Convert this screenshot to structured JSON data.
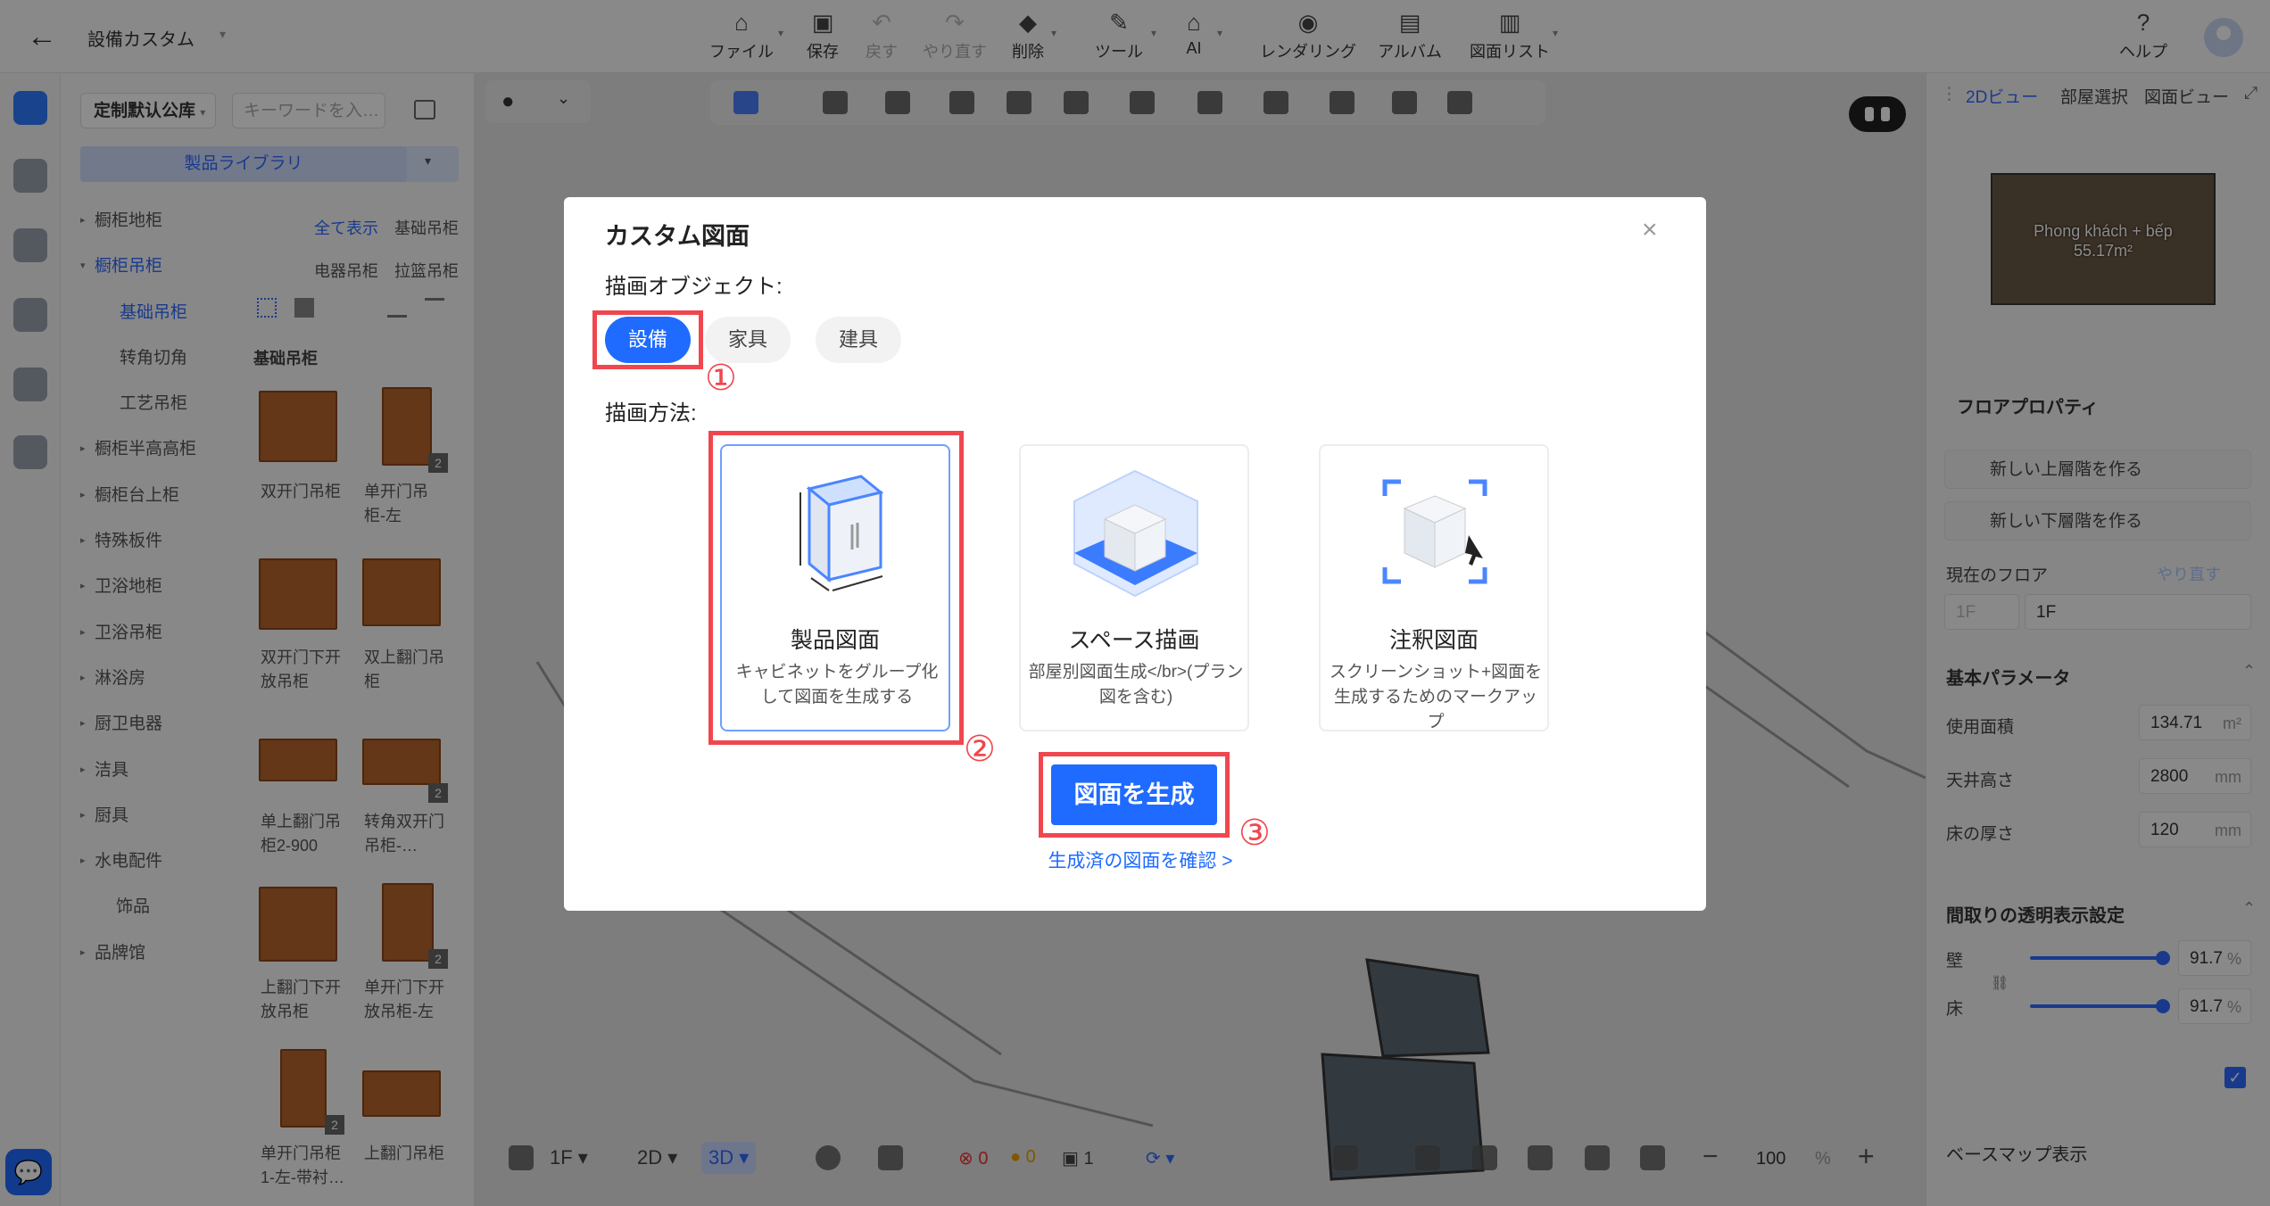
{
  "toolbar": {
    "back_icon": "arrow-left-icon",
    "project_name": "設備カスタム",
    "items": [
      {
        "label": "ファイル",
        "icon": "file-icon"
      },
      {
        "label": "保存",
        "icon": "save-icon"
      },
      {
        "label": "戻す",
        "icon": "undo-icon"
      },
      {
        "label": "やり直す",
        "icon": "redo-icon"
      },
      {
        "label": "削除",
        "icon": "eraser-icon"
      },
      {
        "label": "ツール",
        "icon": "wrench-icon"
      },
      {
        "label": "AI",
        "icon": "ai-house-icon"
      },
      {
        "label": "レンダリング",
        "icon": "camera-icon"
      },
      {
        "label": "アルバム",
        "icon": "album-icon"
      },
      {
        "label": "図面リスト",
        "icon": "document-list-icon"
      }
    ],
    "help_label": "ヘルプ"
  },
  "library": {
    "select_label": "定制默认公库",
    "search_placeholder": "キーワードを入…",
    "tab_label": "製品ライブラリ",
    "tree": [
      {
        "label": "橱柜地柜",
        "type": "collapsed"
      },
      {
        "label": "橱柜吊柜",
        "type": "open"
      },
      {
        "label": "基础吊柜",
        "type": "child-active"
      },
      {
        "label": "转角切角",
        "type": "child"
      },
      {
        "label": "工艺吊柜",
        "type": "child"
      },
      {
        "label": "橱柜半高高柜",
        "type": "collapsed"
      },
      {
        "label": "橱柜台上柜",
        "type": "collapsed"
      },
      {
        "label": "特殊板件",
        "type": "collapsed"
      },
      {
        "label": "卫浴地柜",
        "type": "collapsed"
      },
      {
        "label": "卫浴吊柜",
        "type": "collapsed"
      },
      {
        "label": "淋浴房",
        "type": "collapsed"
      },
      {
        "label": "厨卫电器",
        "type": "collapsed"
      },
      {
        "label": "洁具",
        "type": "collapsed"
      },
      {
        "label": "厨具",
        "type": "collapsed"
      },
      {
        "label": "水电配件",
        "type": "collapsed"
      },
      {
        "label": "饰品",
        "type": "plain"
      },
      {
        "label": "品牌馆",
        "type": "collapsed"
      }
    ],
    "filters": {
      "all": "全て表示",
      "f1": "基础吊柜",
      "f2": "电器吊柜",
      "f3": "拉篮吊柜"
    },
    "section_title": "基础吊柜",
    "products": [
      {
        "label1": "双开门吊柜",
        "label2": "",
        "badge": ""
      },
      {
        "label1": "单开门吊",
        "label2": "柜-左",
        "badge": "2"
      },
      {
        "label1": "双开门下开",
        "label2": "放吊柜",
        "badge": ""
      },
      {
        "label1": "双上翻门吊",
        "label2": "柜",
        "badge": ""
      },
      {
        "label1": "单上翻门吊",
        "label2": "柜2-900",
        "badge": ""
      },
      {
        "label1": "转角双开门",
        "label2": "吊柜-…",
        "badge": "2"
      },
      {
        "label1": "上翻门下开",
        "label2": "放吊柜",
        "badge": ""
      },
      {
        "label1": "单开门下开",
        "label2": "放吊柜-左",
        "badge": "2"
      },
      {
        "label1": "单开门吊柜",
        "label2": "1-左-带衬…",
        "badge": "2"
      },
      {
        "label1": "上翻门吊柜",
        "label2": "",
        "badge": ""
      }
    ]
  },
  "canvas_bottom": {
    "floor": "1F",
    "view2d": "2D",
    "view3d": "3D",
    "err_count": "0",
    "warn_count": "0",
    "info_count": "1",
    "zoom": "100",
    "zoom_unit": "%"
  },
  "right_panel": {
    "tabs": [
      "2Dビュー",
      "部屋選択",
      "図面ビュー"
    ],
    "minimap_label1": "Phong khách + bếp",
    "minimap_label2": "55.17m²",
    "floor_props_title": "フロアプロパティ",
    "new_upper": "新しい上層階を作る",
    "new_lower": "新しい下層階を作る",
    "current_floor_label": "現在のフロア",
    "redo_label": "やり直す",
    "floor_select": "1F",
    "floor_name": "1F",
    "basic_params_title": "基本パラメータ",
    "area_label": "使用面積",
    "area_value": "134.71",
    "area_unit": "m²",
    "ceiling_label": "天井高さ",
    "ceiling_value": "2800",
    "ceiling_unit": "mm",
    "floor_thick_label": "床の厚さ",
    "floor_thick_value": "120",
    "floor_thick_unit": "mm",
    "transparency_title": "間取りの透明表示設定",
    "wall_label": "壁",
    "wall_value": "91.7",
    "floor_label": "床",
    "floor_value": "91.7",
    "pct": "%",
    "basemap_label": "ベースマップ表示"
  },
  "modal": {
    "title": "カスタム図面",
    "object_label": "描画オブジェクト:",
    "objects": [
      "設備",
      "家具",
      "建具"
    ],
    "method_label": "描画方法:",
    "methods": [
      {
        "title": "製品図面",
        "desc": "キャビネットをグループ化して図面を生成する"
      },
      {
        "title": "スペース描画",
        "desc": "部屋別図面生成</br>(プラン図を含む)"
      },
      {
        "title": "注釈図面",
        "desc": "スクリーンショット+図面を生成するためのマークアップ"
      }
    ],
    "generate_label": "図面を生成",
    "check_link": "生成済の図面を確認 >",
    "step1": "①",
    "step2": "②",
    "step3": "③"
  },
  "colors": {
    "accent": "#1f6bff",
    "highlight": "#f0474e"
  }
}
